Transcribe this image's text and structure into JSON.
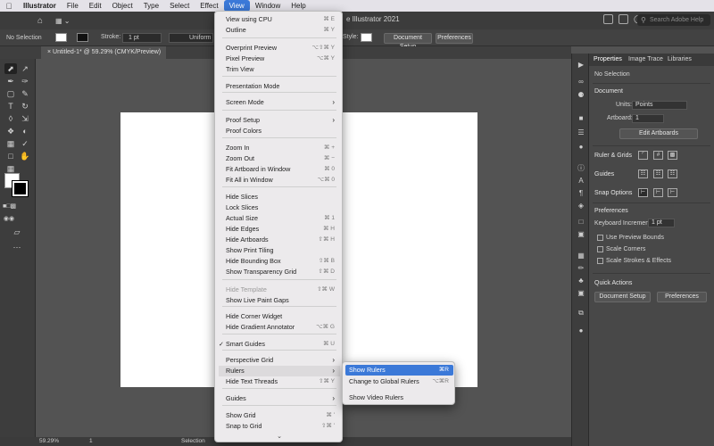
{
  "menubar": {
    "apple": "",
    "items": [
      "Illustrator",
      "File",
      "Edit",
      "Object",
      "Type",
      "Select",
      "Effect",
      "View",
      "Window",
      "Help"
    ],
    "active": "View"
  },
  "appbar": {
    "title": "e Illustrator 2021",
    "search_placeholder": "Search Adobe Help"
  },
  "control_bar": {
    "selection": "No Selection",
    "stroke_label": "Stroke:",
    "stroke_value": "1 pt",
    "profile": "Uniform",
    "style_label": "Style:",
    "doc_setup": "Document Setup",
    "preferences": "Preferences"
  },
  "document": {
    "tab": "Untitled-1* @ 59.29% (CMYK/Preview)"
  },
  "status_bar": {
    "zoom": "59.29%",
    "artboard": "1",
    "mode": "Selection"
  },
  "view_menu": {
    "items": [
      {
        "label": "View using CPU",
        "shortcut": "⌘ E"
      },
      {
        "label": "Outline",
        "shortcut": "⌘ Y"
      },
      {
        "label": "Overprint Preview",
        "shortcut": "⌥⇧⌘ Y"
      },
      {
        "label": "Pixel Preview",
        "shortcut": "⌥⌘ Y"
      },
      {
        "label": "Trim View",
        "shortcut": ""
      },
      {
        "label": "Presentation Mode",
        "shortcut": ""
      },
      {
        "label": "Screen Mode",
        "shortcut": ""
      },
      {
        "label": "Proof Setup",
        "shortcut": ""
      },
      {
        "label": "Proof Colors",
        "shortcut": ""
      },
      {
        "label": "Zoom In",
        "shortcut": "⌘ +"
      },
      {
        "label": "Zoom Out",
        "shortcut": "⌘ −"
      },
      {
        "label": "Fit Artboard in Window",
        "shortcut": "⌘ 0"
      },
      {
        "label": "Fit All in Window",
        "shortcut": "⌥⌘ 0"
      },
      {
        "label": "Hide Slices",
        "shortcut": ""
      },
      {
        "label": "Lock Slices",
        "shortcut": ""
      },
      {
        "label": "Actual Size",
        "shortcut": "⌘ 1"
      },
      {
        "label": "Hide Edges",
        "shortcut": "⌘ H"
      },
      {
        "label": "Hide Artboards",
        "shortcut": "⇧⌘ H"
      },
      {
        "label": "Show Print Tiling",
        "shortcut": ""
      },
      {
        "label": "Hide Bounding Box",
        "shortcut": "⇧⌘ B"
      },
      {
        "label": "Show Transparency Grid",
        "shortcut": "⇧⌘ D"
      },
      {
        "label": "Hide Template",
        "shortcut": "⇧⌘ W"
      },
      {
        "label": "Show Live Paint Gaps",
        "shortcut": ""
      },
      {
        "label": "Hide Corner Widget",
        "shortcut": ""
      },
      {
        "label": "Hide Gradient Annotator",
        "shortcut": "⌥⌘ G"
      },
      {
        "label": "Smart Guides",
        "shortcut": "⌘ U"
      },
      {
        "label": "Perspective Grid",
        "shortcut": ""
      },
      {
        "label": "Rulers",
        "shortcut": ""
      },
      {
        "label": "Hide Text Threads",
        "shortcut": "⇧⌘ Y"
      },
      {
        "label": "Guides",
        "shortcut": ""
      },
      {
        "label": "Show Grid",
        "shortcut": "⌘ '"
      },
      {
        "label": "Snap to Grid",
        "shortcut": "⇧⌘ '"
      }
    ],
    "scroll_arrow": "⌄"
  },
  "rulers_submenu": {
    "items": [
      {
        "label": "Show Rulers",
        "shortcut": "⌘R"
      },
      {
        "label": "Change to Global Rulers",
        "shortcut": "⌥⌘R"
      },
      {
        "label": "Show Video Rulers",
        "shortcut": ""
      }
    ]
  },
  "properties_panel": {
    "tabs": [
      "Properties",
      "Image Trace",
      "Libraries"
    ],
    "no_selection": "No Selection",
    "document_header": "Document",
    "units_label": "Units:",
    "units_value": "Points",
    "artboard_label": "Artboard:",
    "artboard_value": "1",
    "edit_artboards": "Edit Artboards",
    "ruler_grids": "Ruler & Grids",
    "guides": "Guides",
    "snap_options": "Snap Options",
    "preferences_header": "Preferences",
    "keyboard_increment_label": "Keyboard Increment:",
    "keyboard_increment_value": "1 pt",
    "use_preview_bounds": "Use Preview Bounds",
    "scale_corners": "Scale Corners",
    "scale_strokes": "Scale Strokes & Effects",
    "quick_actions": "Quick Actions",
    "doc_setup_btn": "Document Setup",
    "prefs_btn": "Preferences"
  }
}
